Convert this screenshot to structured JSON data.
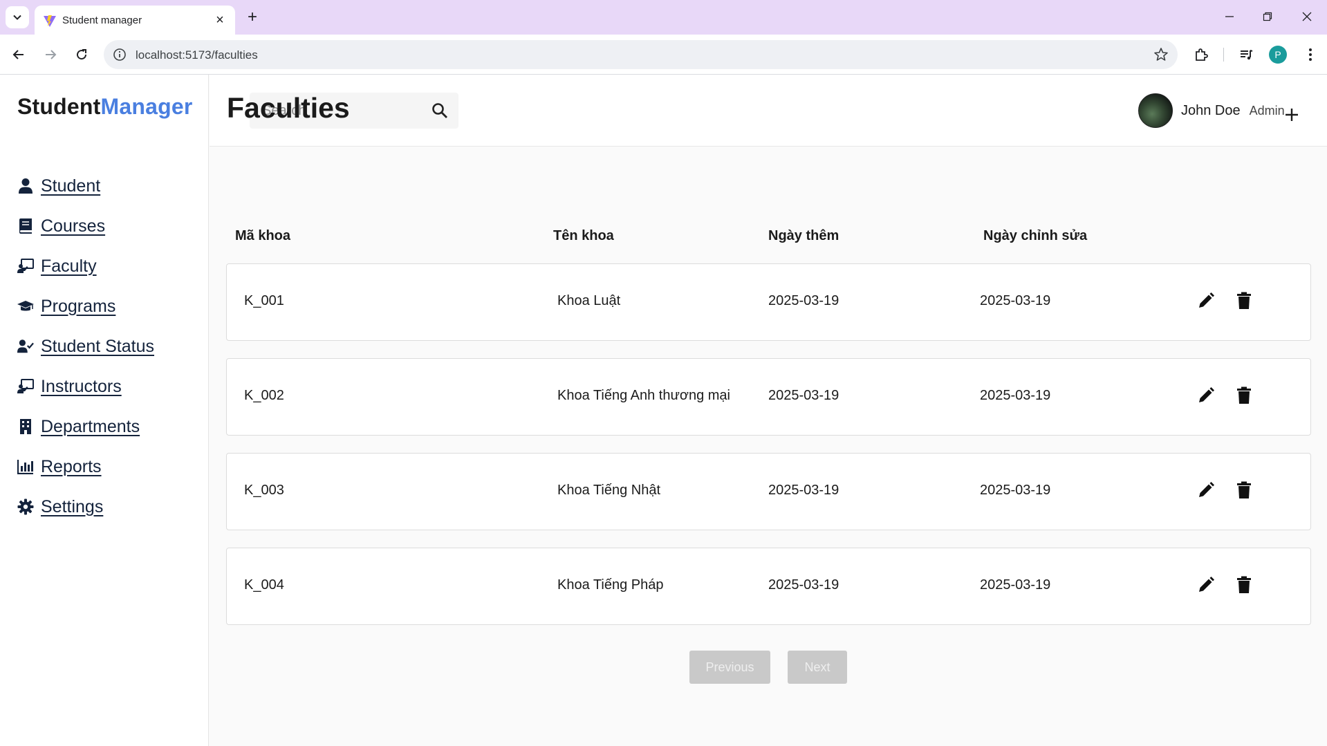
{
  "browser": {
    "tab_title": "Student manager",
    "url": "localhost:5173/faculties",
    "profile_initial": "P"
  },
  "app": {
    "logo_part1": "Student",
    "logo_part2": "Manager",
    "brand_color": "#4a7fe0"
  },
  "sidebar": {
    "items": [
      {
        "label": "Student",
        "icon": "user-icon"
      },
      {
        "label": "Courses",
        "icon": "book-icon"
      },
      {
        "label": "Faculty",
        "icon": "chalkboard-teacher-icon"
      },
      {
        "label": "Programs",
        "icon": "graduation-cap-icon"
      },
      {
        "label": "Student Status",
        "icon": "user-check-icon"
      },
      {
        "label": "Instructors",
        "icon": "chalkboard-teacher-icon"
      },
      {
        "label": "Departments",
        "icon": "building-icon"
      },
      {
        "label": "Reports",
        "icon": "bar-chart-icon"
      },
      {
        "label": "Settings",
        "icon": "gear-icon"
      }
    ]
  },
  "header": {
    "search_placeholder": "Search",
    "user_name": "John Doe",
    "user_role": "Admin"
  },
  "page": {
    "title": "Faculties"
  },
  "table": {
    "columns": [
      "Mã khoa",
      "Tên khoa",
      "Ngày thêm",
      "Ngày chỉnh sửa"
    ],
    "rows": [
      {
        "code": "K_001",
        "name": "Khoa Luật",
        "created": "2025-03-19",
        "updated": "2025-03-19"
      },
      {
        "code": "K_002",
        "name": "Khoa Tiếng Anh thương mại",
        "created": "2025-03-19",
        "updated": "2025-03-19"
      },
      {
        "code": "K_003",
        "name": "Khoa Tiếng Nhật",
        "created": "2025-03-19",
        "updated": "2025-03-19"
      },
      {
        "code": "K_004",
        "name": "Khoa Tiếng Pháp",
        "created": "2025-03-19",
        "updated": "2025-03-19"
      }
    ]
  },
  "pagination": {
    "previous_label": "Previous",
    "next_label": "Next"
  }
}
